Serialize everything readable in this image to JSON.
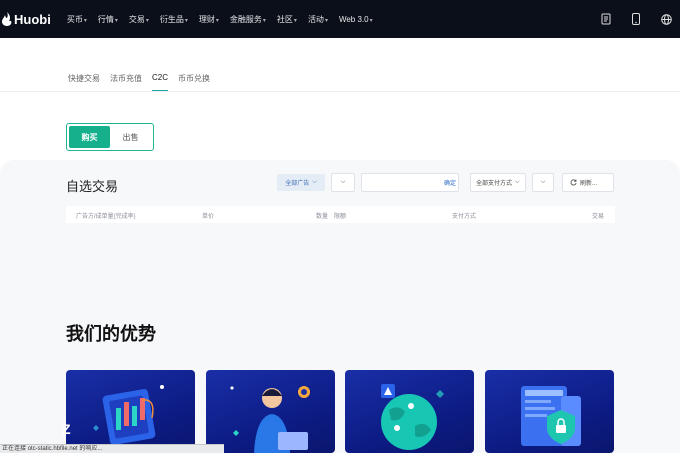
{
  "brand": {
    "name": "Huobi"
  },
  "nav": {
    "items": [
      {
        "label": "买币",
        "dropdown": true
      },
      {
        "label": "行情",
        "dropdown": true
      },
      {
        "label": "交易",
        "dropdown": true
      },
      {
        "label": "衍生品",
        "dropdown": true
      },
      {
        "label": "理财",
        "dropdown": true
      },
      {
        "label": "金融服务",
        "dropdown": true
      },
      {
        "label": "社区",
        "dropdown": true
      },
      {
        "label": "活动",
        "dropdown": true
      },
      {
        "label": "Web 3.0",
        "dropdown": true
      }
    ],
    "caret": "▾",
    "right_icons": [
      "document-icon",
      "mobile-icon",
      "globe-icon"
    ]
  },
  "subtabs": {
    "items": [
      "快捷交易",
      "法币充值",
      "C2C",
      "币币兑换"
    ],
    "active": "C2C"
  },
  "toggle": {
    "buy": "购买",
    "sell": "出售",
    "active": "buy"
  },
  "trade": {
    "title": "自选交易",
    "filters": {
      "ads": "全部广告",
      "search_placeholder": "",
      "confirm": "确定",
      "payment": "全部支付方式",
      "refresh": "刷新..."
    },
    "columns": [
      "广告方/成单量(完成率)",
      "单价",
      "数量",
      "限额",
      "支付方式",
      "交易"
    ]
  },
  "advantages": {
    "title": "我们的优势"
  },
  "statusbar": {
    "text": "正在连接 otc-static.hbfile.net 的响应..."
  },
  "colors": {
    "nav_bg": "#0a0f1a",
    "accent": "#16b08d",
    "tab_underline": "#1ea6a6",
    "card_bg": "#1a2fa7"
  }
}
